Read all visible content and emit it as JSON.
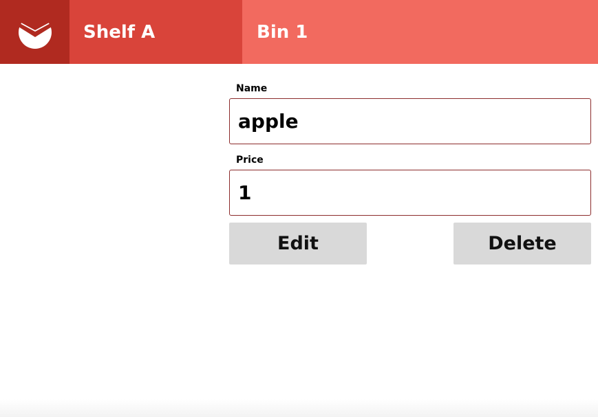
{
  "header": {
    "logo_icon": "checkmark-circle-icon",
    "shelf_label": "Shelf A",
    "bin_label": "Bin 1",
    "colors": {
      "logo_bg": "#b02a20",
      "shelf_bg": "#d9443a",
      "bin_bg": "#f26a5f"
    }
  },
  "form": {
    "name_label": "Name",
    "name_value": "apple",
    "price_label": "Price",
    "price_value": "1",
    "input_border_color": "#8b2b2b"
  },
  "actions": {
    "edit_label": "Edit",
    "delete_label": "Delete",
    "button_bg": "#d9d9d9"
  }
}
